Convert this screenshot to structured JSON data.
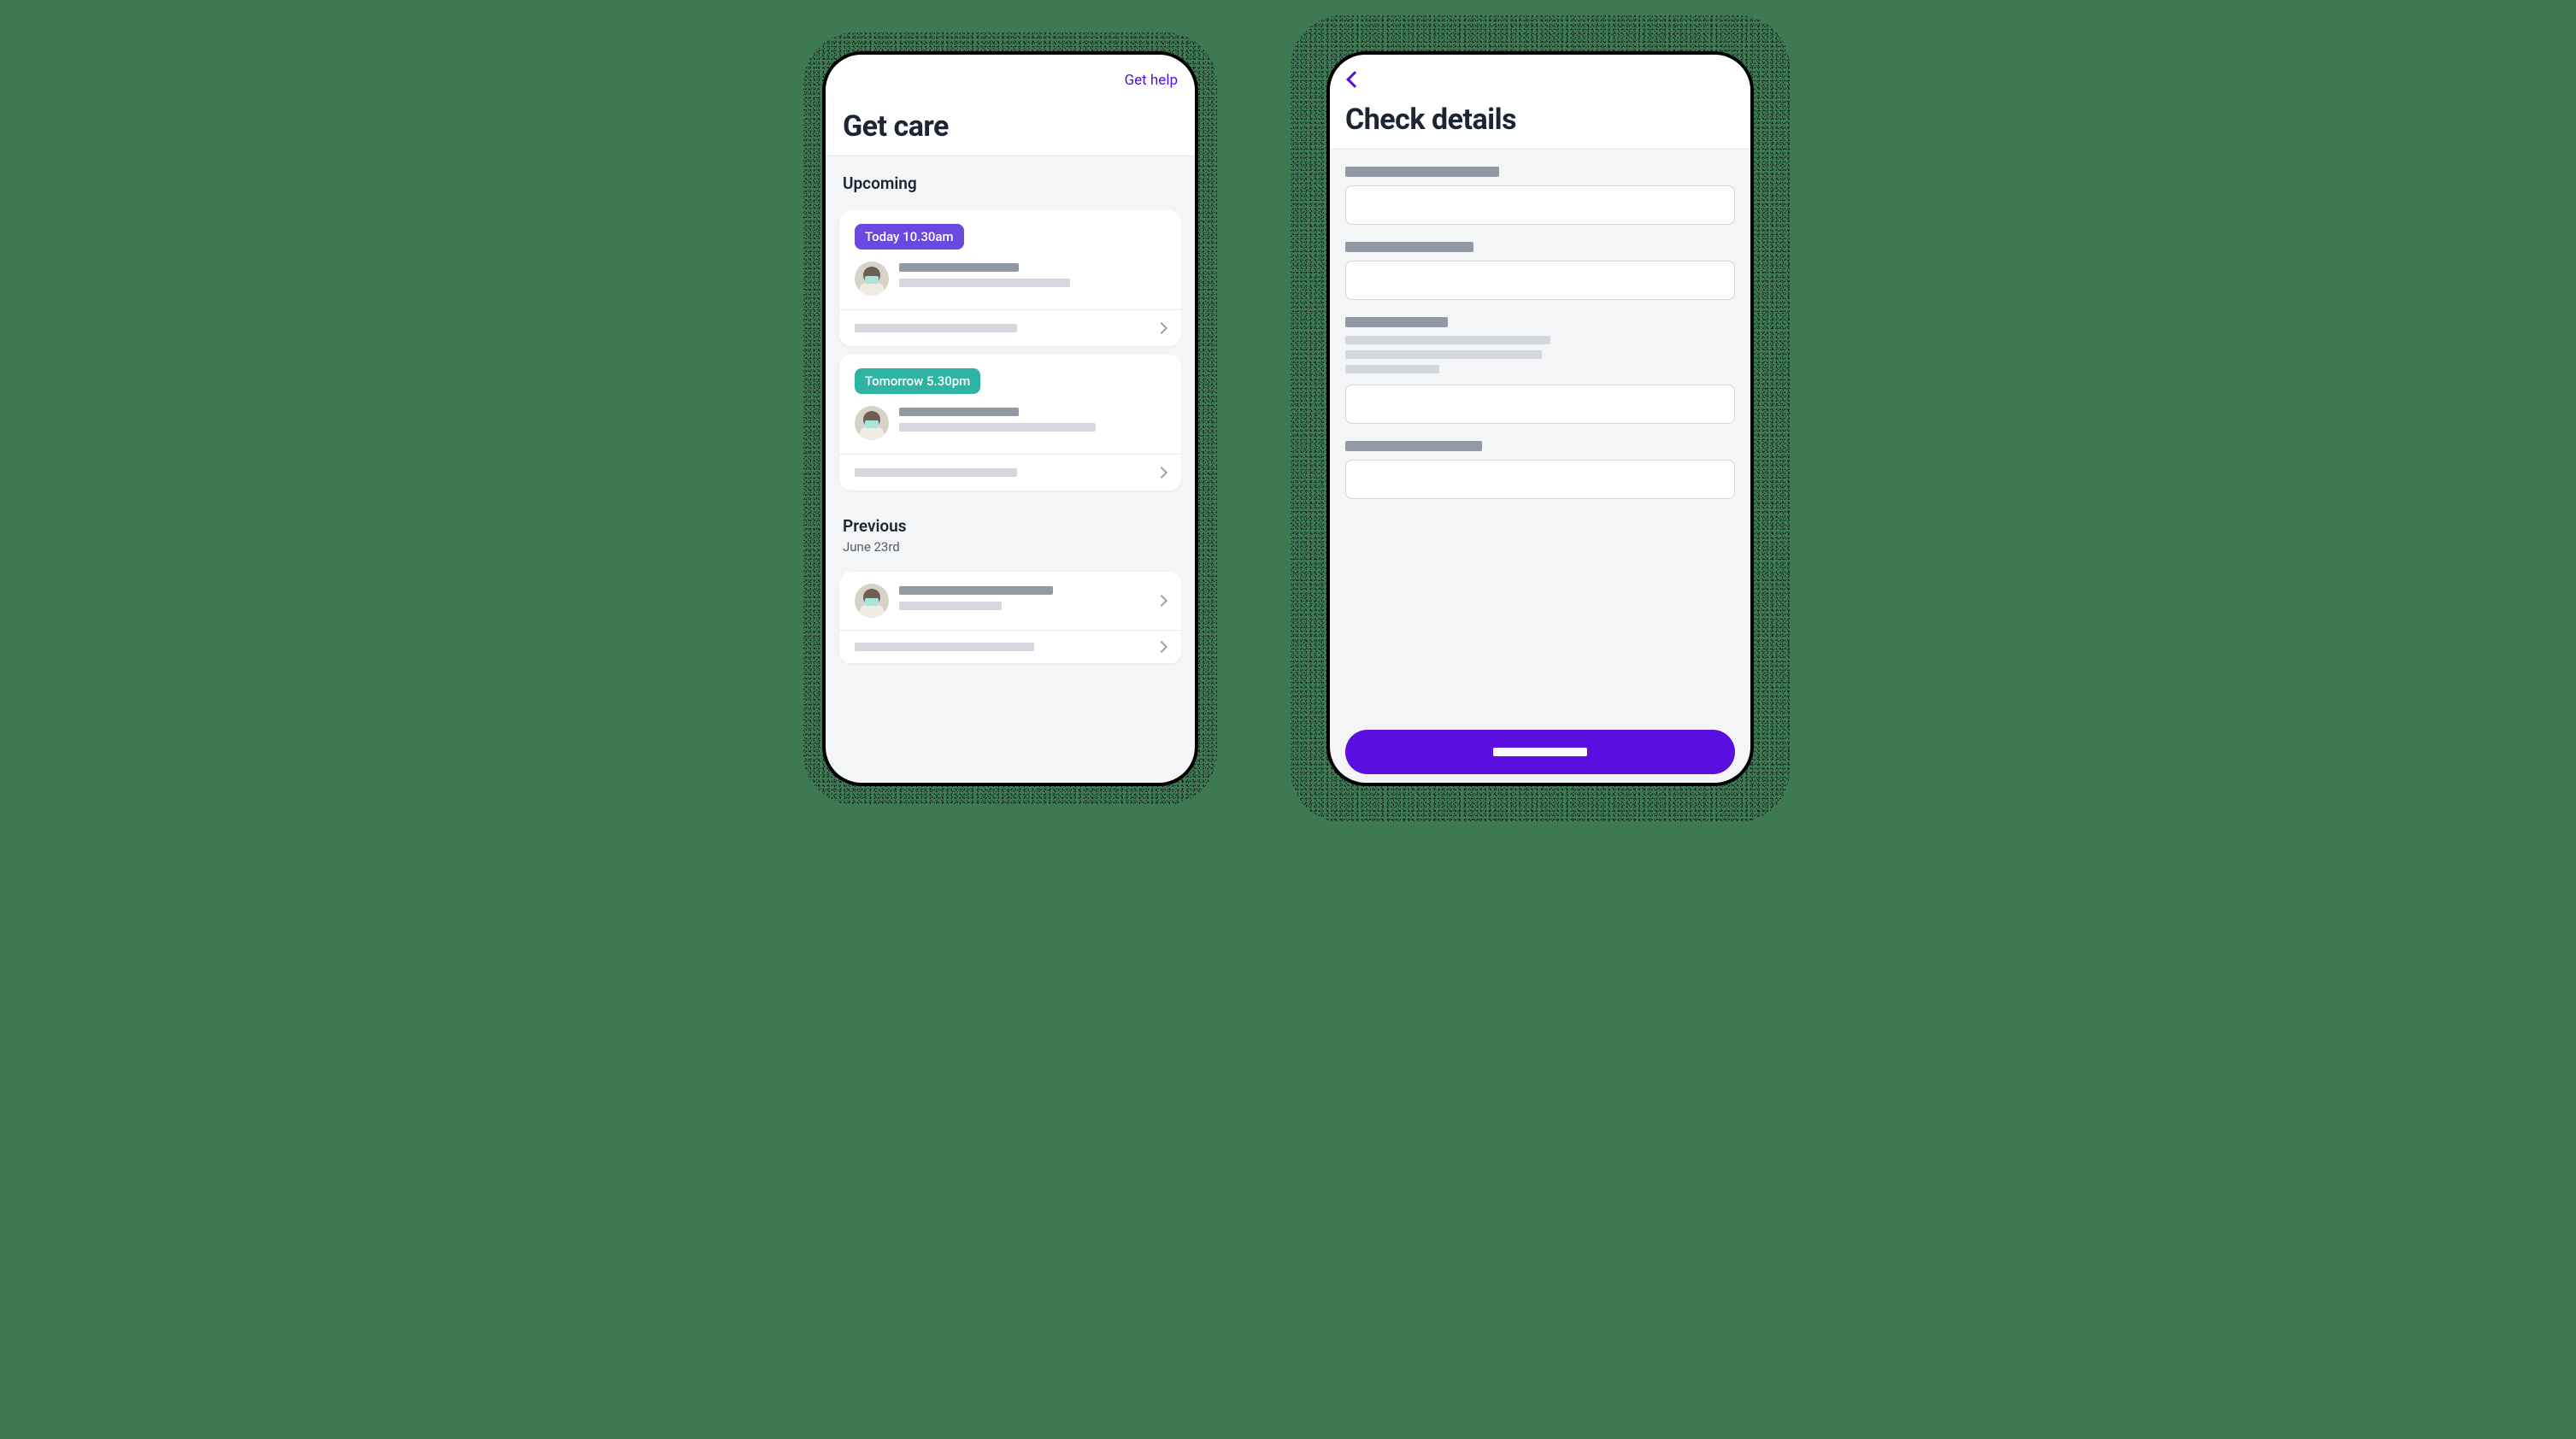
{
  "colors": {
    "accent_purple": "#5a0ee0",
    "badge_purple": "#6a49e0",
    "badge_teal": "#2fb3a3",
    "page_bg": "#3d7a52"
  },
  "phone_left": {
    "header": {
      "help_link": "Get help",
      "title": "Get care"
    },
    "sections": {
      "upcoming": {
        "title": "Upcoming",
        "cards": [
          {
            "badge_text": "Today 10.30am",
            "badge_variant": "purple"
          },
          {
            "badge_text": "Tomorrow 5.30pm",
            "badge_variant": "teal"
          }
        ]
      },
      "previous": {
        "title": "Previous",
        "date": "June 23rd"
      }
    }
  },
  "phone_right": {
    "header": {
      "title": "Check details"
    }
  }
}
